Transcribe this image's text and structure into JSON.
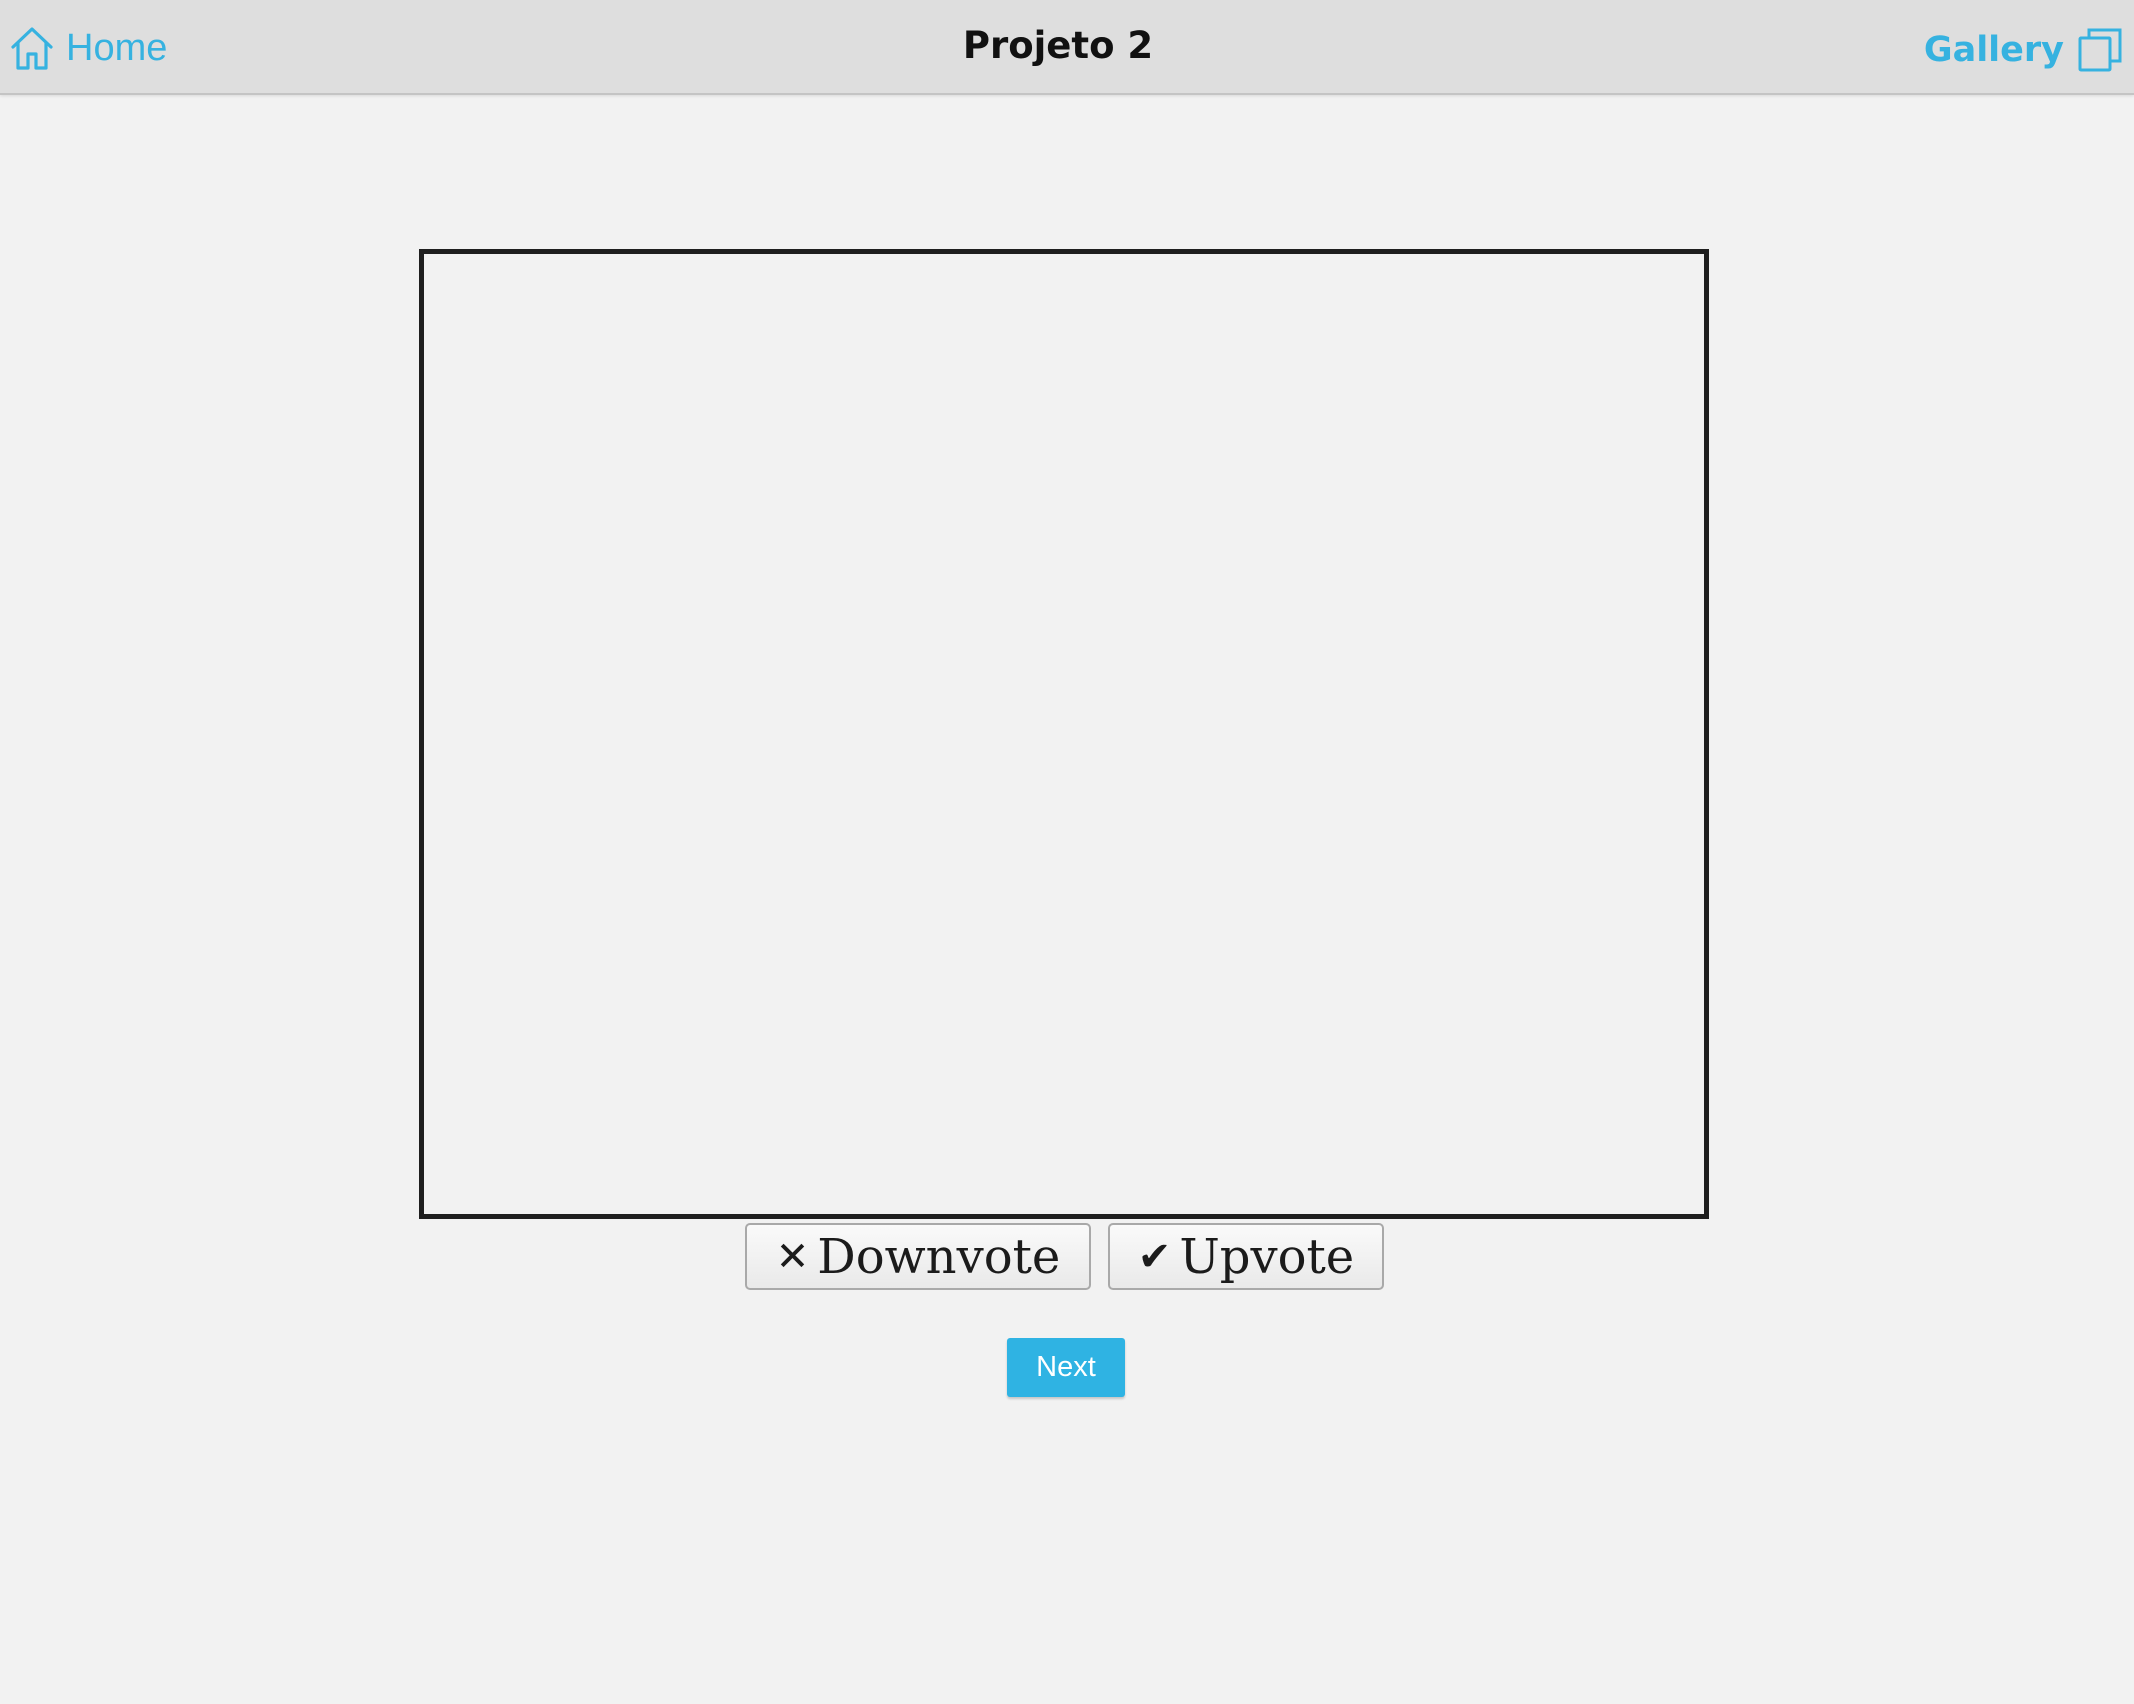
{
  "header": {
    "home_label": "Home",
    "title": "Projeto 2",
    "gallery_label": "Gallery",
    "home_icon": "home-icon",
    "gallery_icon": "gallery-icon"
  },
  "votes": {
    "downvote_icon": "✕",
    "downvote_label": "Downvote",
    "upvote_icon": "✔",
    "upvote_label": "Upvote"
  },
  "actions": {
    "next_label": "Next"
  },
  "colors": {
    "accent": "#36b2e0",
    "header_bg": "#dedede",
    "page_bg": "#f2f2f2",
    "next_button": "#2fb3e3",
    "frame_border": "#1f1f1f"
  }
}
